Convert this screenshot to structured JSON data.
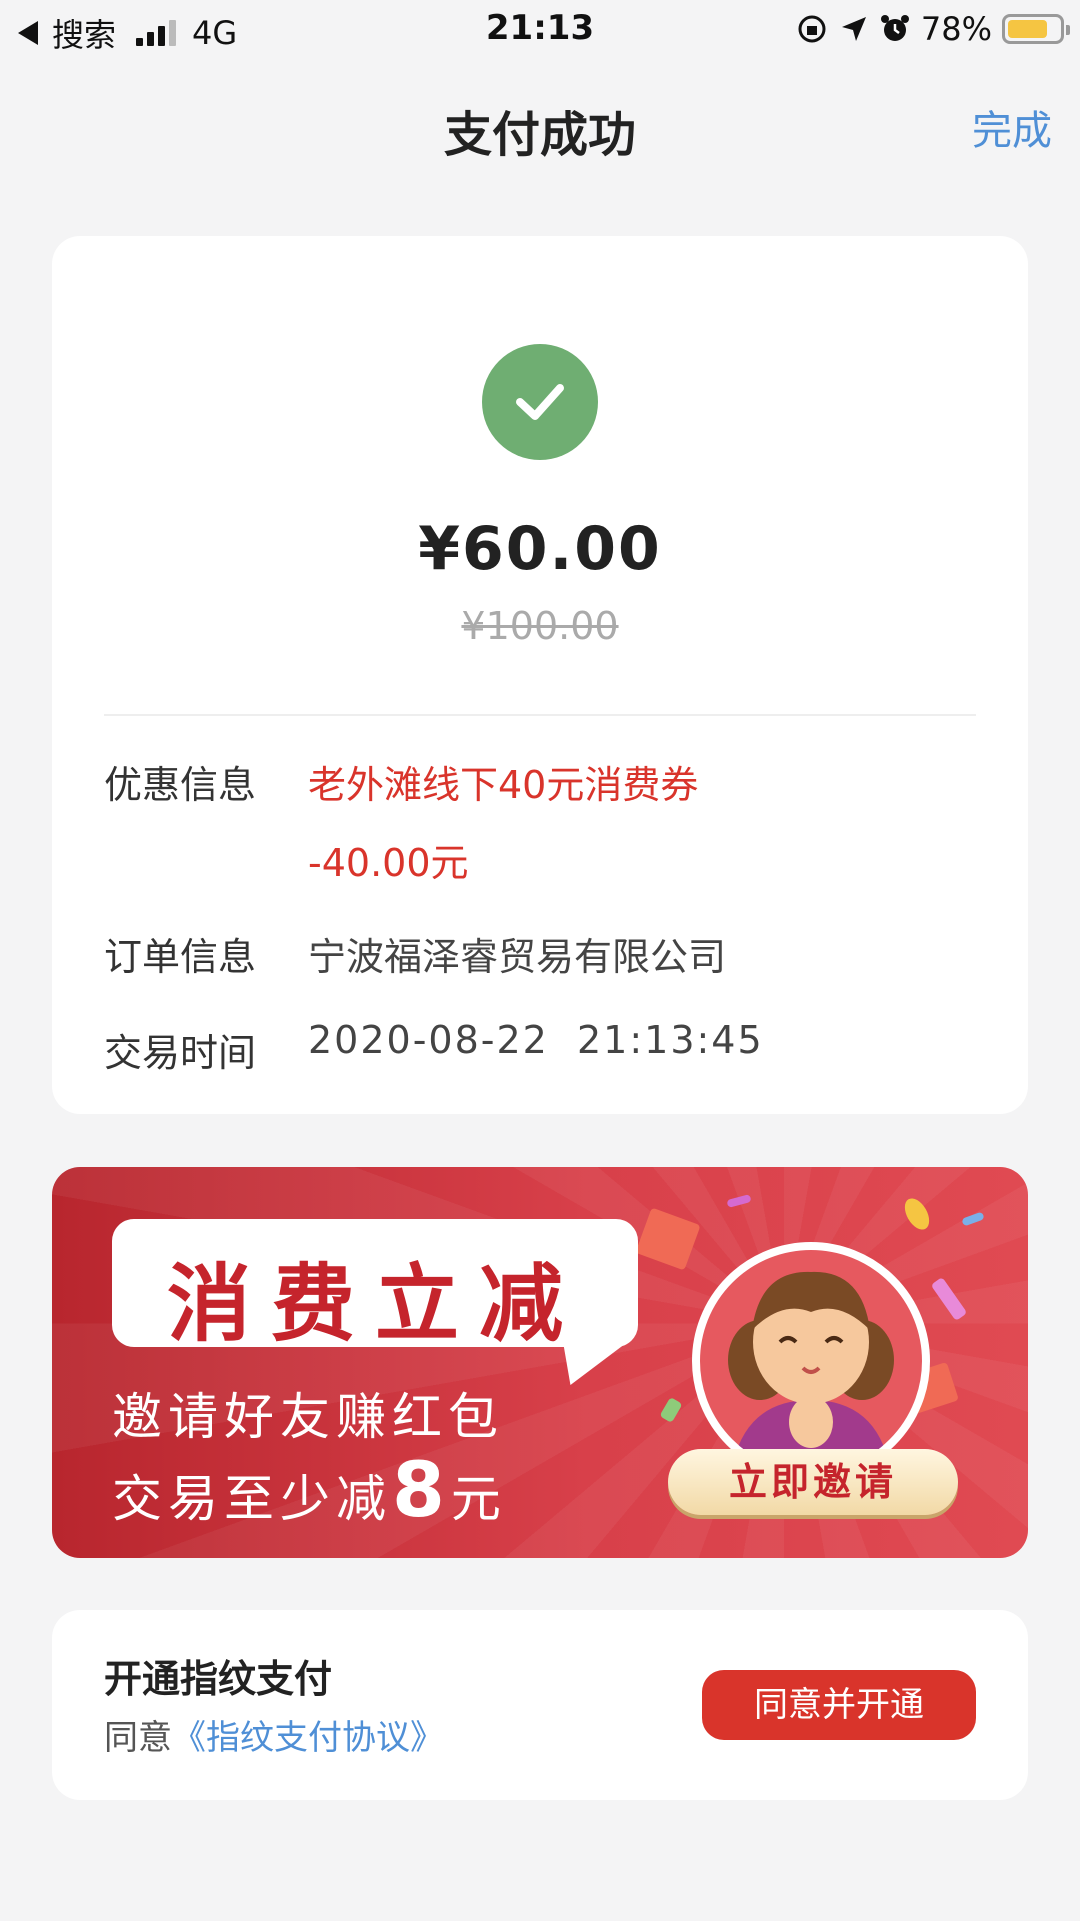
{
  "status_bar": {
    "back_app": "搜索",
    "network": "4G",
    "time": "21:13",
    "battery": "78%",
    "battery_level": 0.78
  },
  "nav": {
    "title": "支付成功",
    "done": "完成"
  },
  "payment": {
    "amount": "¥60.00",
    "original_amount": "¥100.00",
    "rows": {
      "discount_label": "优惠信息",
      "discount_name": "老外滩线下40元消费券",
      "discount_value": "-40.00元",
      "order_label": "订单信息",
      "order_value": "宁波福泽睿贸易有限公司",
      "time_label": "交易时间",
      "time_value": "2020-08-22  21:13:45"
    }
  },
  "banner": {
    "headline": "消费立减",
    "line1": "邀请好友赚红包",
    "line2_prefix": "交易至少减",
    "line2_number": "8",
    "line2_suffix": "元",
    "button": "立即邀请"
  },
  "fingerprint": {
    "title": "开通指纹支付",
    "agree_prefix": "同意",
    "agreement_link": "《指纹支付协议》",
    "button": "同意并开通"
  },
  "colors": {
    "accent_blue": "#4f8fd6",
    "success_green": "#6fae72",
    "alert_red": "#d9342b",
    "banner_red": "#c5242c"
  }
}
